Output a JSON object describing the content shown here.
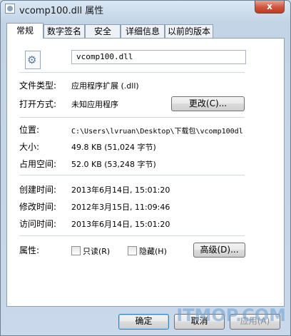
{
  "window": {
    "title": "vcomp100.dll 属性",
    "close_label": "x"
  },
  "tabs": [
    {
      "label": "常规",
      "active": true
    },
    {
      "label": "数字签名",
      "active": false
    },
    {
      "label": "安全",
      "active": false
    },
    {
      "label": "详细信息",
      "active": false
    },
    {
      "label": "以前的版本",
      "active": false
    }
  ],
  "file": {
    "icon": "dll-file-icon",
    "name": "vcomp100.dll"
  },
  "fields": {
    "type_label": "文件类型:",
    "type_value": "应用程序扩展 (.dll)",
    "open_label": "打开方式:",
    "open_value": "未知应用程序",
    "change_button": "更改(C)...",
    "location_label": "位置:",
    "location_value": "C:\\Users\\lvruan\\Desktop\\下载包\\vcomp100dl",
    "size_label": "大小:",
    "size_value": "49.8 KB (51,024 字节)",
    "disk_label": "占用空间:",
    "disk_value": "52.0 KB (53,248 字节)",
    "created_label": "创建时间:",
    "created_value": "2013年6月14日, 15:01:20",
    "modified_label": "修改时间:",
    "modified_value": "2012年3月15日, 11:09:46",
    "accessed_label": "访问时间:",
    "accessed_value": "2013年6月14日, 15:01:20",
    "attr_label": "属性:",
    "readonly_label": "只读(R)",
    "hidden_label": "隐藏(H)",
    "advanced_button": "高级(D)..."
  },
  "buttons": {
    "ok": "确定",
    "cancel": "取消",
    "apply": "应用(A)"
  },
  "watermark": "ITMOP.COM"
}
